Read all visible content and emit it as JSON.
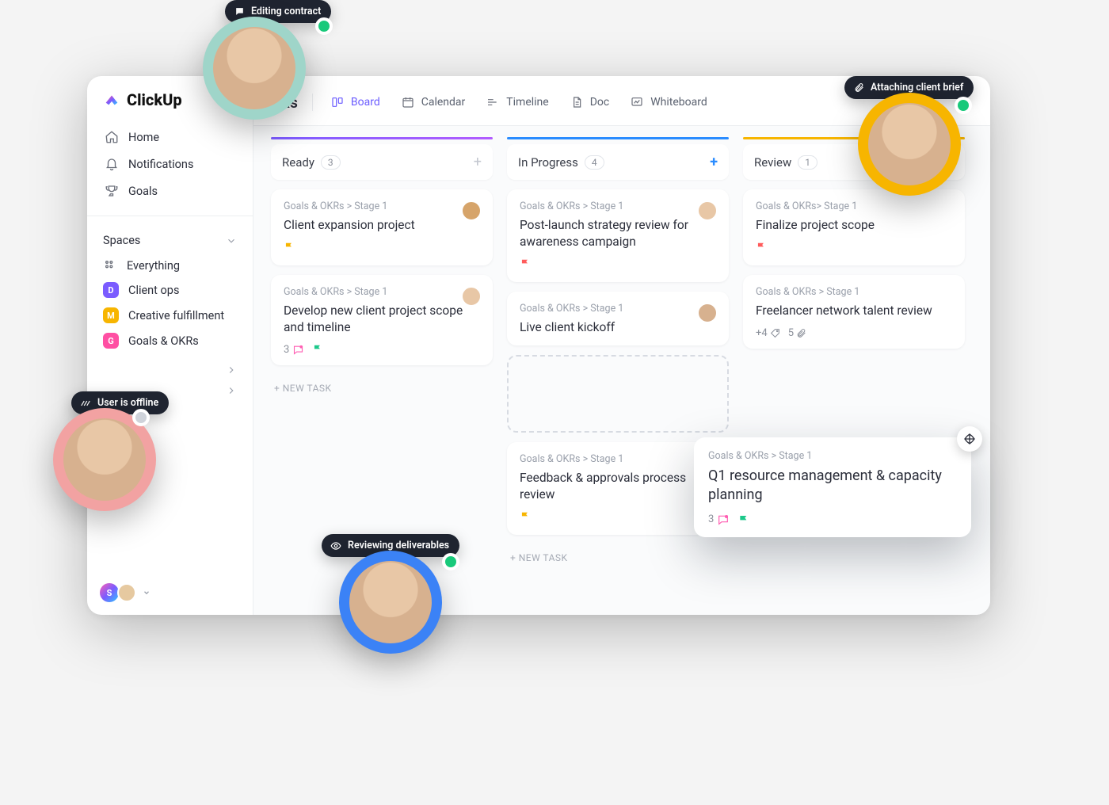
{
  "brand": {
    "name": "ClickUp"
  },
  "nav": {
    "home": "Home",
    "notifications": "Notifications",
    "goals": "Goals"
  },
  "spaces": {
    "header": "Spaces",
    "everything": "Everything",
    "items": [
      {
        "letter": "D",
        "label": "Client ops",
        "color": "#7b5cff"
      },
      {
        "letter": "M",
        "label": "Creative fulfillment",
        "color": "#f7b500"
      },
      {
        "letter": "G",
        "label": "Goals & OKRs",
        "color": "#ff4fa3"
      }
    ]
  },
  "topbar": {
    "title_suffix": "KRs",
    "tabs": {
      "board": "Board",
      "calendar": "Calendar",
      "timeline": "Timeline",
      "doc": "Doc",
      "whiteboard": "Whiteboard"
    }
  },
  "columns": {
    "ready": {
      "title": "Ready",
      "count": "3"
    },
    "inprogress": {
      "title": "In Progress",
      "count": "4"
    },
    "review": {
      "title": "Review",
      "count": "1"
    }
  },
  "crumb": "Goals & OKRs > Stage 1",
  "crumb_tight": "Goals & OKRs> Stage 1",
  "cards": {
    "ready": [
      {
        "title": "Client expansion project",
        "flag": "#f7b500",
        "avatar": "#d6a46a"
      },
      {
        "title": "Develop new client project scope and timeline",
        "flag": "#1cc88a",
        "avatar": "#e8c7a6",
        "comments": "3"
      }
    ],
    "inprogress": [
      {
        "title": "Post-launch strategy review for awareness campaign",
        "flag": "#ff5b5b",
        "avatar": "#e8c7a6"
      },
      {
        "title": "Live client kickoff",
        "avatar": "#d7b18f"
      },
      {
        "title": "Feedback & approvals process review",
        "flag": "#f7b500"
      }
    ],
    "review": [
      {
        "title": "Finalize project scope",
        "flag": "#ff5b5b"
      },
      {
        "title": "Freelancer network talent review",
        "extra_tags": "+4",
        "attachments": "5"
      }
    ]
  },
  "floating_card": {
    "title": "Q1 resource management & capacity planning",
    "comments": "3",
    "flag": "#1cc88a",
    "avatar": "#f2d7a6"
  },
  "new_task_label": "+ NEW TASK",
  "presence": {
    "editing": "Editing contract",
    "offline": "User is offline",
    "reviewing": "Reviewing deliverables",
    "attaching": "Attaching client brief"
  },
  "sidebar_footer_initial": "S"
}
